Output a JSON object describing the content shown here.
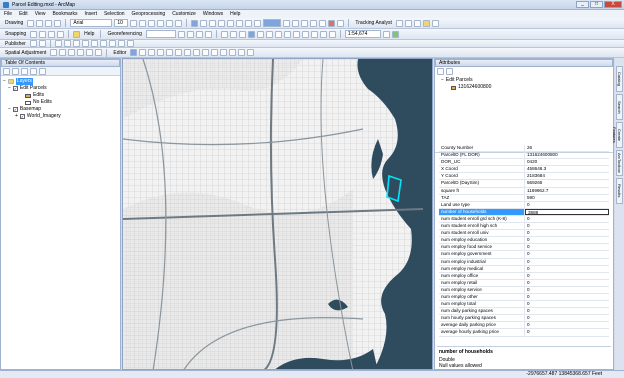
{
  "window": {
    "title": "Parcel Editing.mxd - ArcMap",
    "buttons": [
      "_",
      "□",
      "X"
    ]
  },
  "menu": [
    "File",
    "Edit",
    "View",
    "Bookmarks",
    "Insert",
    "Selection",
    "Geoprocessing",
    "Customize",
    "Windows",
    "Help"
  ],
  "toolbar1": {
    "drawing_label": "Drawing",
    "font_name": "Arial",
    "font_size": "10",
    "tracking_label": "Tracking Analyst"
  },
  "toolbar2": {
    "snapping_label": "Snapping",
    "help_label": "Help",
    "georef_label": "Georeferencing",
    "scale_value": "1:54,674"
  },
  "toolbar3": {
    "publisher_label": "Publisher"
  },
  "toolbar4": {
    "spatial_label": "Spatial Adjustment",
    "editor_label": "Editor"
  },
  "toc": {
    "title": "Table Of Contents",
    "items": {
      "layers": "Layers",
      "edit_parcels": "Edit Parcels",
      "edits": "Edits",
      "no_edits": "No Edits",
      "basemap": "Basemap",
      "world_imagery": "World_Imagery"
    }
  },
  "attributes": {
    "title": "Attributes",
    "tree_layer": "Edit Parcels",
    "tree_feature": "131624600800",
    "rows": [
      {
        "k": "County Number",
        "v": "26"
      },
      {
        "k": "ParcelID (FL DOR)",
        "v": "131624600800"
      },
      {
        "k": "DOR_UC",
        "v": "0420"
      },
      {
        "k": "X Coord",
        "v": "458646.3"
      },
      {
        "k": "Y Coord",
        "v": "2183684"
      },
      {
        "k": "ParcelID (DaySim)",
        "v": "569265"
      },
      {
        "k": "square ft",
        "v": "1169962.7"
      },
      {
        "k": "TAZ",
        "v": "590"
      },
      {
        "k": "Land use type",
        "v": "0"
      },
      {
        "k": "number of households",
        "v": "3888"
      },
      {
        "k": "num student enroll grd sch (K-8)",
        "v": "0"
      },
      {
        "k": "num student enroll high sch",
        "v": "0"
      },
      {
        "k": "num student enroll univ",
        "v": "0"
      },
      {
        "k": "num employ education",
        "v": "0"
      },
      {
        "k": "num employ food service",
        "v": "0"
      },
      {
        "k": "num employ government",
        "v": "0"
      },
      {
        "k": "num employ industrial",
        "v": "0"
      },
      {
        "k": "num employ medical",
        "v": "0"
      },
      {
        "k": "num employ office",
        "v": "0"
      },
      {
        "k": "num employ retail",
        "v": "0"
      },
      {
        "k": "num employ service",
        "v": "0"
      },
      {
        "k": "num employ other",
        "v": "0"
      },
      {
        "k": "num employ total",
        "v": "0"
      },
      {
        "k": "num daily parking spaces",
        "v": "0"
      },
      {
        "k": "num hourly parking spaces",
        "v": "0"
      },
      {
        "k": "average daily parking price",
        "v": "0"
      },
      {
        "k": "average hourly parking price",
        "v": "0"
      }
    ],
    "selected_index": 9,
    "desc_title": "number of households",
    "desc_type": "Double",
    "desc_null": "Null values allowed"
  },
  "sidetabs": [
    "Catalog",
    "Search",
    "Create Features",
    "ArcToolbox",
    "Results"
  ],
  "status": {
    "coords": "-2976657.487  13845368.657 Feet"
  },
  "colors": {
    "water": "#2f4b5e",
    "selection_outline": "#00e5ff",
    "selected_row": "#3399ff"
  }
}
